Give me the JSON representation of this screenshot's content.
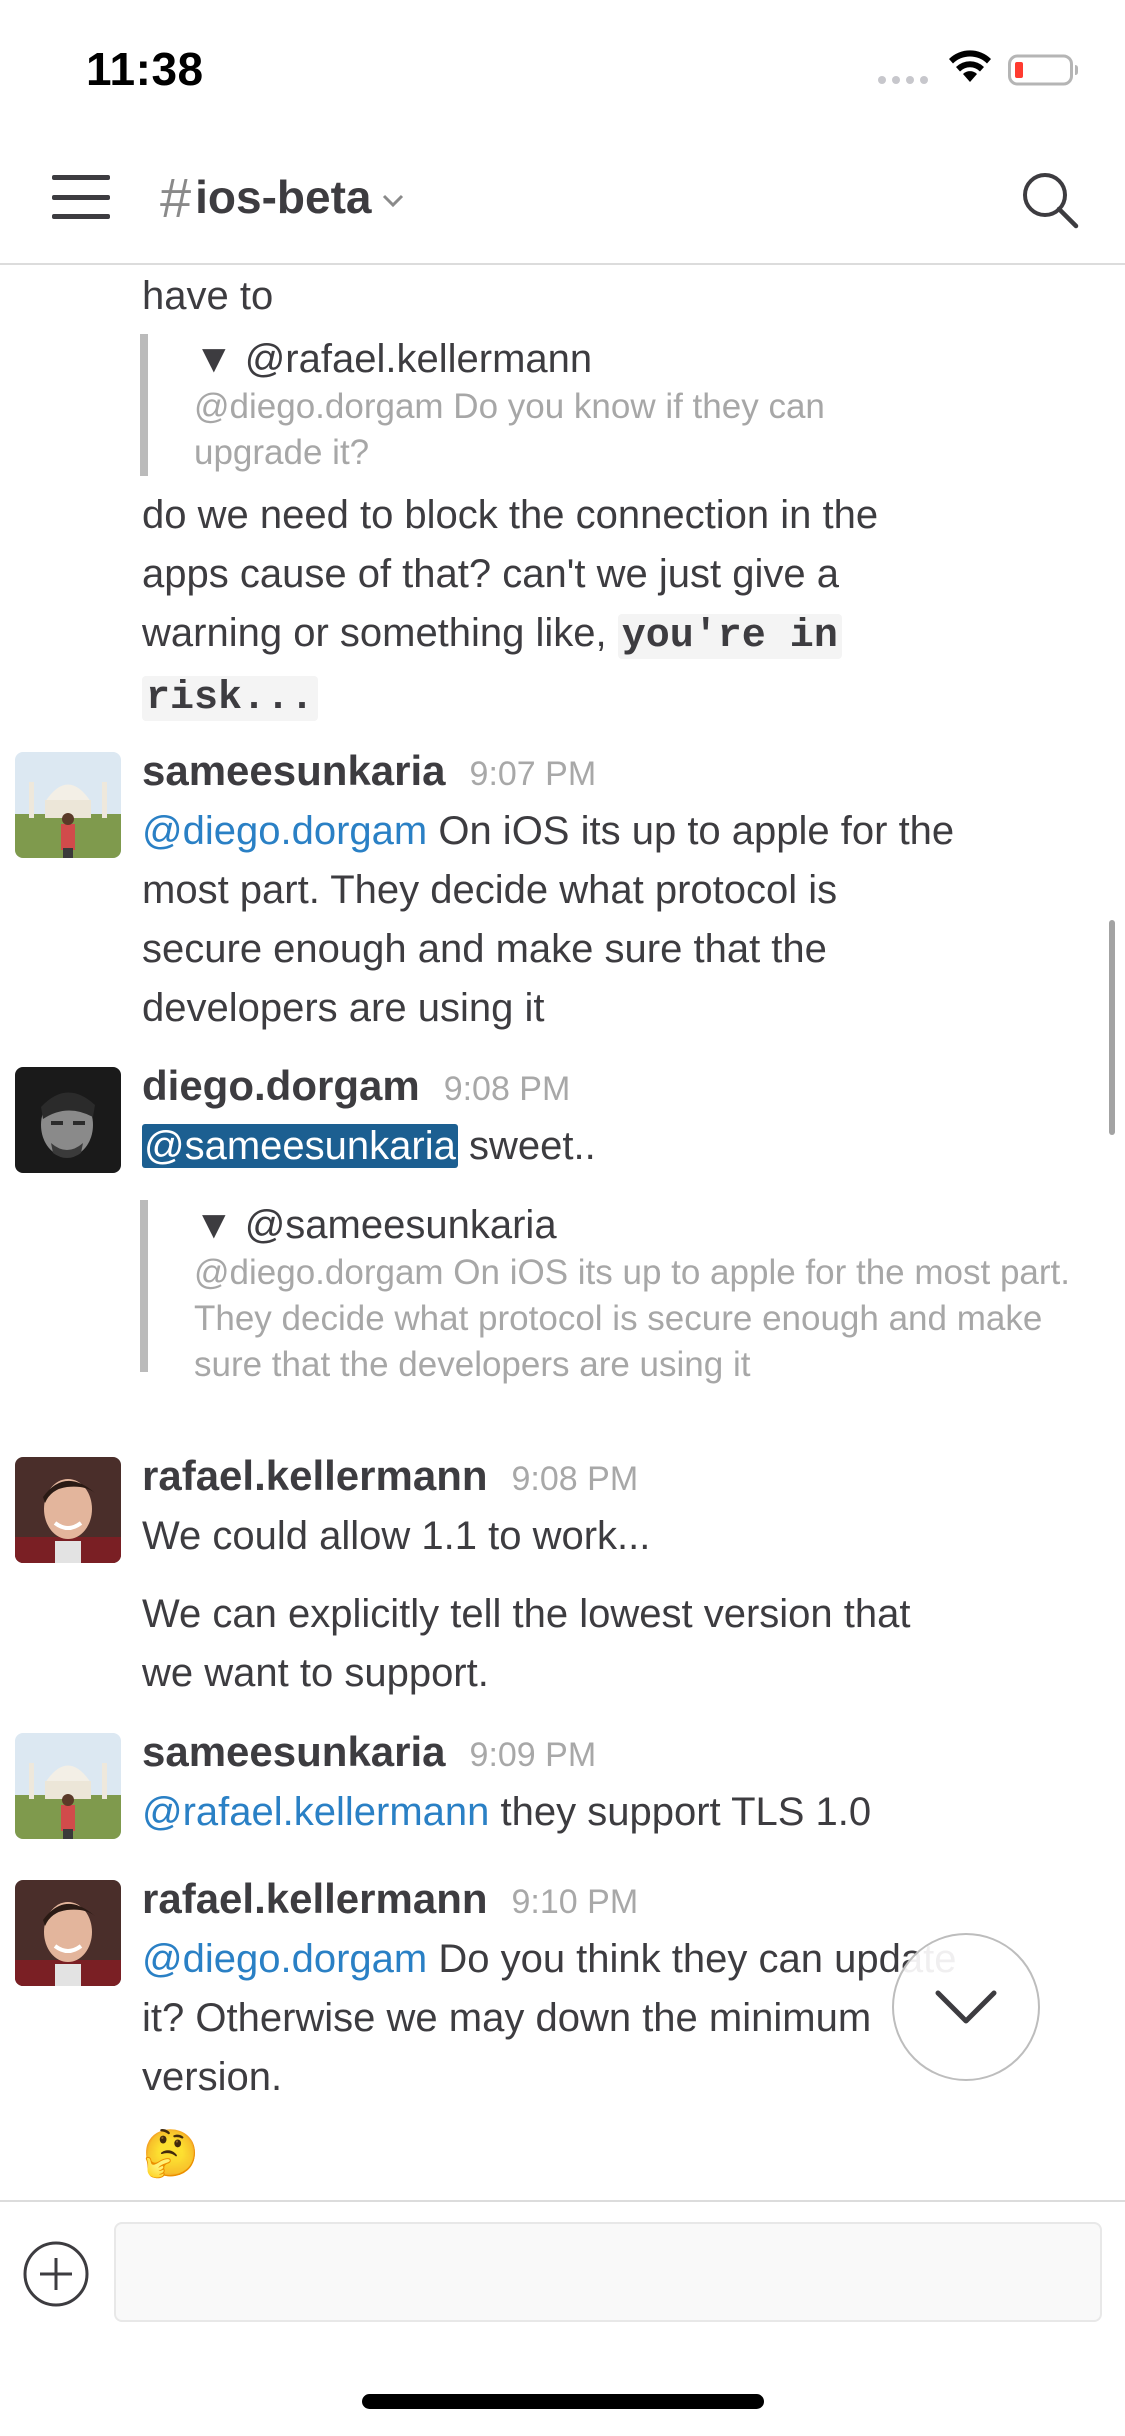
{
  "status_bar": {
    "time": "11:38"
  },
  "header": {
    "channel_hash": "#",
    "channel_name": "ios-beta"
  },
  "messages": {
    "m1_text": "have to",
    "m1_quote_author": "▼ @rafael.kellermann",
    "m1_quote_body": "@diego.dorgam Do you know if they can upgrade it?",
    "m2_text_line1": "do we need to block the connection in the",
    "m2_text_line2": "apps cause of that? can't we just give a",
    "m2_text_line3_prefix": "warning or something like, ",
    "m2_code_part1": "you're in",
    "m2_code_part2": "risk...",
    "m3_user": "sameesunkaria",
    "m3_time": "9:07 PM",
    "m3_mention": "@diego.dorgam",
    "m3_text_line1": " On iOS its up to apple for the",
    "m3_text_line2": "most part. They decide what protocol is",
    "m3_text_line3": "secure enough and make sure that the",
    "m3_text_line4": "developers are using it",
    "m4_user": "diego.dorgam",
    "m4_time": "9:08 PM",
    "m4_mention": "@sameesunkaria",
    "m4_text": " sweet..",
    "m4_quote_author": "▼ @sameesunkaria",
    "m4_quote_body": "@diego.dorgam On iOS its up to apple for the most part. They decide what protocol is secure enough and make sure that the developers are using it",
    "m5_user": "rafael.kellermann",
    "m5_time": "9:08 PM",
    "m5_text": "We could allow 1.1 to work...",
    "m5b_text_line1": "We can explicitly tell the lowest version that",
    "m5b_text_line2": "we want to support.",
    "m6_user": "sameesunkaria",
    "m6_time": "9:09 PM",
    "m6_mention": "@rafael.kellermann",
    "m6_text": " they support TLS 1.0",
    "m7_user": "rafael.kellermann",
    "m7_time": "9:10 PM",
    "m7_mention": "@diego.dorgam",
    "m7_text_line1": " Do you think they can update",
    "m7_text_line2": "it? Otherwise we may down the minimum",
    "m7_text_line3": "version.",
    "m7_emoji": "🤔"
  },
  "composer": {
    "placeholder": ""
  },
  "icons": {
    "menu": "hamburger-icon",
    "search": "search-icon",
    "chevron": "chevron-down-icon",
    "add": "plus-circle-icon",
    "jump": "chevron-down-icon"
  },
  "colors": {
    "mention": "#2a80c5",
    "mention_self_bg": "#1c5f91",
    "text": "#3d3c40",
    "muted": "#a8a8a8"
  }
}
